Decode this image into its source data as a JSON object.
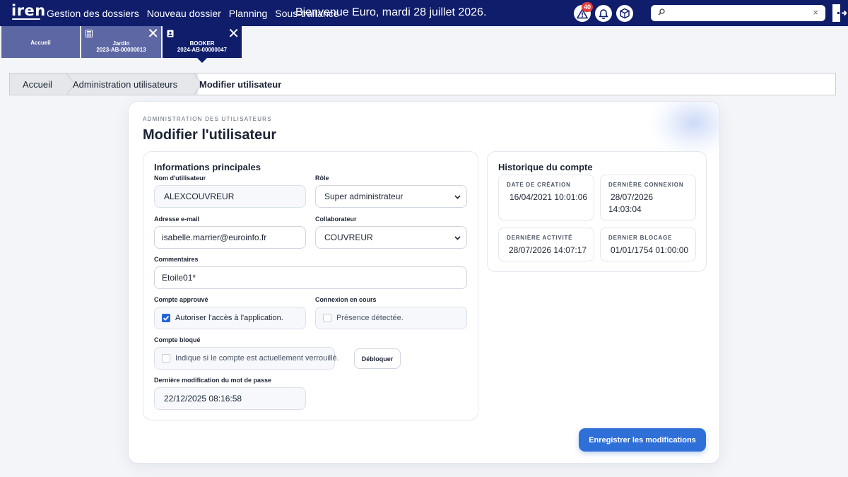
{
  "app": {
    "logo_text": "iren"
  },
  "nav": {
    "items": [
      "Gestion des dossiers",
      "Nouveau dossier",
      "Planning",
      "Sous-traitance"
    ],
    "welcome": "Bienvenue Euro, mardi 28 juillet 2026."
  },
  "top_icons": {
    "alerts_count": "40"
  },
  "search": {
    "value": "",
    "clear_glyph": "×"
  },
  "tabs": [
    {
      "label": "Accueil"
    },
    {
      "line1": "Jardin",
      "line2": "2023-AB-00000013",
      "close": "✕"
    },
    {
      "line1": "BOOKER",
      "line2": "2024-AB-00000047",
      "close": "✕"
    }
  ],
  "breadcrumb": [
    "Accueil",
    "Administration utilisateurs",
    "Modifier utilisateur"
  ],
  "card": {
    "eyebrow": "ADMINISTRATION DES UTILISATEURS",
    "title": "Modifier l'utilisateur"
  },
  "main": {
    "title": "Informations principales",
    "username_label": "Nom d'utilisateur",
    "username_value": "ALEXCOUVREUR",
    "role_label": "Rôle",
    "role_value": "Super administrateur",
    "email_label": "Adresse e-mail",
    "email_value": "isabelle.marrier@euroinfo.fr",
    "collab_label": "Collaborateur",
    "collab_value": "COUVREUR",
    "comments_label": "Commentaires",
    "comments_value": "Etoile01*",
    "approved_label": "Compte approuvé",
    "approved_text": "Autoriser l'accès à l'application.",
    "approved_checked": true,
    "session_label": "Connexion en cours",
    "session_text": "Présence détectée.",
    "session_checked": false,
    "locked_label": "Compte bloqué",
    "locked_text": "Indique si le compte est actuellement verrouillé.",
    "locked_checked": false,
    "unlock_label": "Débloquer",
    "pwd_label": "Dernière modification du mot de passe",
    "pwd_value": "22/12/2025 08:16:58"
  },
  "history": {
    "title": "Historique du compte",
    "created_label": "DATE DE CRÉATION",
    "created_value": "16/04/2021 10:01:06",
    "last_login_label": "DERNIÈRE CONNEXION",
    "last_login_line1": "28/07/2026",
    "last_login_line2": "14:03:04",
    "last_activity_label": "DERNIÈRE ACTIVITÉ",
    "last_activity_value": "28/07/2026 14:07:17",
    "last_block_label": "DERNIER BLOCAGE",
    "last_block_value": "01/01/1754 01:00:00"
  },
  "actions": {
    "save_label": "Enregistrer les modifications"
  },
  "colors": {
    "navy": "#0f1d6b",
    "tab_inactive": "#5d67a4",
    "primary": "#2f6fd8",
    "alert": "#e23d3d"
  }
}
